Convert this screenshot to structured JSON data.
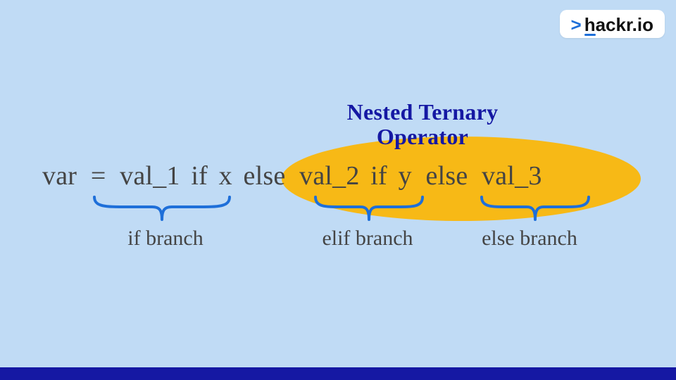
{
  "logo": {
    "caret": ">",
    "text": "hackr.io"
  },
  "title_line1": "Nested Ternary",
  "title_line2": "Operator",
  "code": {
    "t1": "var",
    "t2": "=",
    "t3": "val_1",
    "t4": "if",
    "t5": "x",
    "t6": "else",
    "t7": "val_2",
    "t8": "if",
    "t9": "y",
    "t10": "else",
    "t11": "val_3"
  },
  "branches": {
    "b1": "if branch",
    "b2": "elif branch",
    "b3": "else branch"
  },
  "colors": {
    "bg": "#c0dbf5",
    "accent": "#1518a3",
    "highlight": "#f7b916",
    "brace": "#1e6fd9"
  }
}
